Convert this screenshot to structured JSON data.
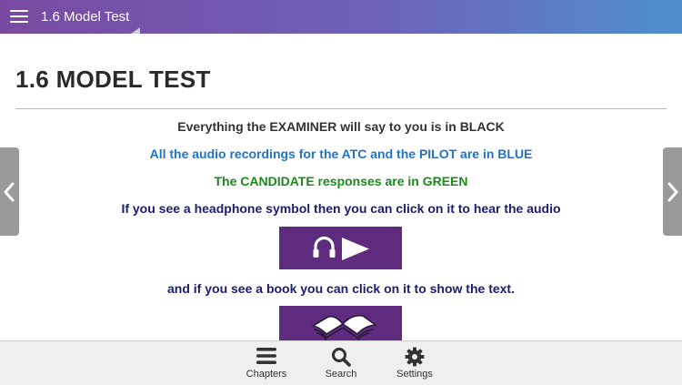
{
  "topbar": {
    "title": "1.6 Model Test",
    "menu_icon": "hamburger-menu-icon"
  },
  "page": {
    "heading": "1.6 MODEL TEST",
    "lines": [
      "Everything the EXAMINER will say to you is in BLACK",
      "All the audio recordings for the ATC and the PILOT are in BLUE",
      "The CANDIDATE responses are in GREEN",
      "If you see a headphone symbol then you can click on it to hear the audio",
      "and if you see a book you can click on it to show the text."
    ],
    "line_colors": [
      "#333333",
      "#1f74c9",
      "#1b8a1b",
      "#1c1c72",
      "#1c1c72"
    ],
    "audio_button_icons": [
      "headphone-icon",
      "play-icon"
    ],
    "book_button_icon": "open-book-icon",
    "button_color": "#5e2b7e"
  },
  "nav": {
    "prev_icon": "chevron-left-icon",
    "next_icon": "chevron-right-icon"
  },
  "bottom_nav": {
    "items": [
      {
        "label": "Chapters",
        "icon": "list-icon"
      },
      {
        "label": "Search",
        "icon": "search-icon"
      },
      {
        "label": "Settings",
        "icon": "gear-icon"
      }
    ]
  }
}
